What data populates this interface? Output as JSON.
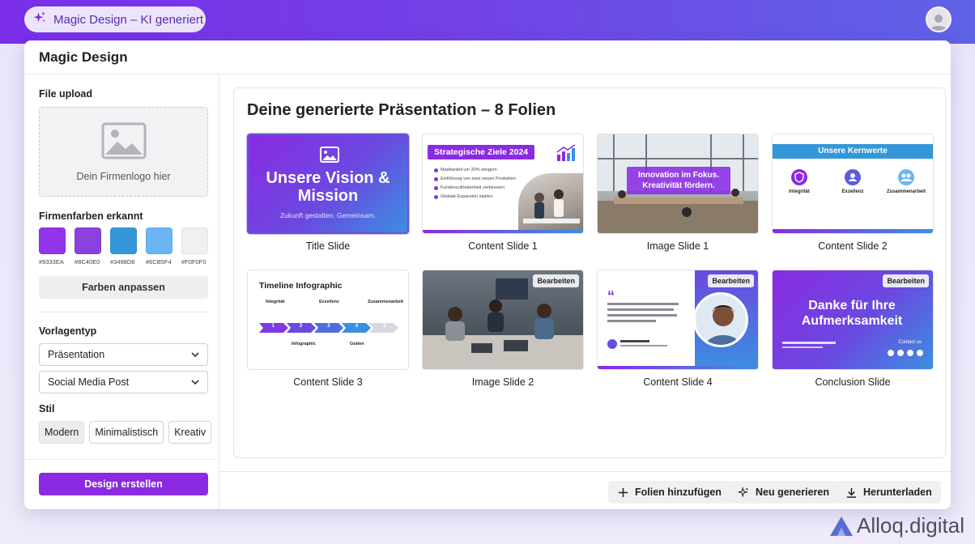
{
  "topbar": {
    "pill_label": "Magic Design – KI generiert"
  },
  "window": {
    "title": "Magic Design"
  },
  "sidebar": {
    "file_upload_label": "File upload",
    "upload_placeholder": "Dein Firmenlogo hier",
    "colors_label": "Firmenfarben erkannt",
    "colors": [
      {
        "hex": "#9333EA",
        "label": "#9333EA"
      },
      {
        "hex": "#8C40E0",
        "label": "#8C40E0"
      },
      {
        "hex": "#3498D8",
        "label": "#3498D8"
      },
      {
        "hex": "#6CB5F4",
        "label": "#6CB5F4"
      },
      {
        "hex": "#F0F0F0",
        "label": "#F0F0F0"
      }
    ],
    "adjust_colors_button": "Farben anpassen",
    "template_label": "Vorlagentyp",
    "template_select_1": "Präsentation",
    "template_select_2": "Social Media Post",
    "style_label": "Stil",
    "styles": [
      "Modern",
      "Minimalistisch",
      "Kreativ"
    ],
    "active_style": "Modern",
    "create_button": "Design erstellen"
  },
  "main": {
    "title": "Deine generierte Präsentation – 8 Folien",
    "slides": [
      {
        "label": "Title Slide",
        "heading": "Unsere Vision & Mission",
        "sub": "Zukunft gestalten. Gemeinsam."
      },
      {
        "label": "Content Slide 1",
        "heading": "Strategische Ziele 2024",
        "bullets": [
          "Marktanteil um 20% steigern",
          "Einführung von zwei neuen Produkten",
          "Kundenzufriedenheit verbessern",
          "Globale Expansion starten"
        ]
      },
      {
        "label": "Image Slide 1",
        "overlay": "Innovation im Fokus. Kreativität fördern."
      },
      {
        "label": "Content Slide 2",
        "heading": "Unsere Kernwerte",
        "values": [
          "Integrität",
          "Exzellenz",
          "Zusammenarbeit"
        ]
      },
      {
        "label": "Content Slide 3",
        "heading": "Timeline Infographic",
        "steps_top": [
          "Integrität",
          "Exzellenz",
          "Zusammenarbeit"
        ],
        "steps_bottom": [
          "Infographic",
          "Gotten"
        ],
        "numbers": [
          "1",
          "2",
          "3",
          "4",
          "5"
        ]
      },
      {
        "label": "Image Slide 2",
        "badge": "Bearbeiten"
      },
      {
        "label": "Content Slide 4",
        "badge": "Bearbeiten"
      },
      {
        "label": "Conclusion Slide",
        "badge": "Bearbeiten",
        "heading": "Danke für Ihre Aufmerksamkeit",
        "contact": "Contact us"
      }
    ]
  },
  "footer": {
    "add_slides": "Folien hinzufügen",
    "regenerate": "Neu generieren",
    "download": "Herunterladen"
  },
  "brand": {
    "name": "Alloq.digital"
  },
  "colors": {
    "accent": "#8a2be2",
    "topbar_start": "#7a2ee8",
    "topbar_end": "#5e63e6"
  }
}
